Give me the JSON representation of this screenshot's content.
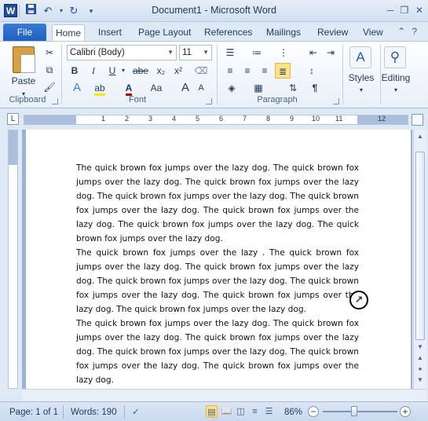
{
  "window": {
    "title": "Document1  -  Microsoft Word",
    "app_icon": "W",
    "qat": {
      "save_icon": "save-icon",
      "undo_icon": "undo-icon",
      "redo_icon": "repeat-icon"
    }
  },
  "tabs": [
    {
      "label": "File"
    },
    {
      "label": "Home"
    },
    {
      "label": "Insert"
    },
    {
      "label": "Page Layout"
    },
    {
      "label": "References"
    },
    {
      "label": "Mailings"
    },
    {
      "label": "Review"
    },
    {
      "label": "View"
    }
  ],
  "ribbon": {
    "clipboard": {
      "label": "Clipboard",
      "paste": "Paste"
    },
    "font": {
      "label": "Font",
      "family": "Calibri (Body)",
      "size": "11",
      "bold": "B",
      "italic": "I",
      "underline": "U",
      "strike": "abe",
      "subscript": "x₂",
      "superscript": "x²",
      "grow": "A",
      "shrink": "A",
      "case": "Aa"
    },
    "paragraph": {
      "label": "Paragraph"
    },
    "styles": {
      "label": "Styles"
    },
    "editing": {
      "label": "Editing"
    }
  },
  "ruler": {
    "numbers": [
      "1",
      "2",
      "3",
      "4",
      "5",
      "6",
      "7",
      "8",
      "9",
      "10",
      "11",
      "12"
    ]
  },
  "document": {
    "paragraphs": [
      "The quick brown fox jumps over the lazy dog. The quick brown fox jumps over the lazy dog. The quick brown fox jumps over the lazy dog. The quick brown fox jumps over the lazy dog. The quick brown fox jumps over the lazy dog. The quick brown fox jumps over the lazy dog. The quick brown fox jumps over the lazy dog. The quick brown fox jumps over the lazy dog.",
      "The quick brown fox jumps over the lazy . The quick brown fox jumps over the lazy dog. The quick brown fox jumps over the lazy dog. The quick brown fox jumps over the lazy dog. The quick brown fox jumps over the lazy dog. The quick brown fox jumps over the lazy dog. The quick brown fox jumps over the lazy dog.",
      "The quick brown fox jumps over the lazy dog. The quick brown fox jumps over the lazy dog. The quick brown fox jumps over the lazy dog. The quick brown fox jumps over the lazy dog. The quick brown fox jumps over the lazy dog. The quick brown fox jumps over the lazy dog."
    ]
  },
  "status": {
    "page": "Page: 1 of 1",
    "words": "Words: 190",
    "zoom": "86%"
  },
  "colors": {
    "file_tab": "#1f5fbf",
    "ribbon_bg": "#e9f0f9",
    "doc_bg": "#9ab3d5"
  }
}
